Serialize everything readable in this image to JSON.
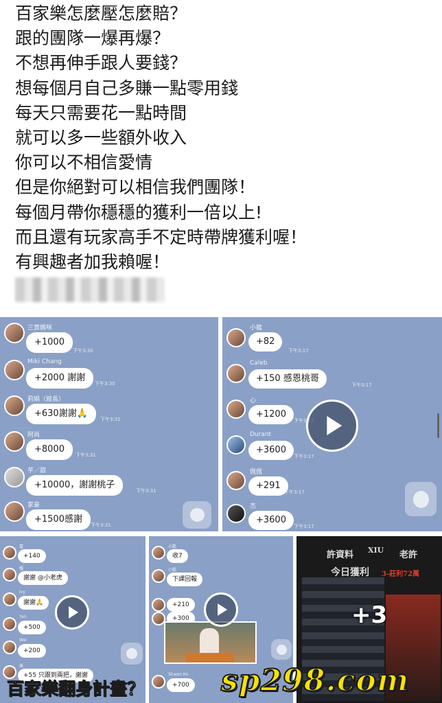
{
  "post": {
    "lines": [
      "百家樂怎麼壓怎麼賠？",
      "跟的團隊一爆再爆？",
      "不想再伸手跟人要錢？",
      "想每個月自己多賺一點零用錢",
      "每天只需要花一點時間",
      "就可以多一些額外收入",
      "你可以不相信愛情",
      "但是你絕對可以相信我們團隊！",
      "每個月帶你穩穩的獲利一倍以上!",
      "而且還有玩家高手不定時帶牌獲利喔！",
      "有興趣者加我賴喔！"
    ]
  },
  "gallery": {
    "panel1": {
      "messages": [
        {
          "name": "三寶媽咪",
          "text": "+1000",
          "time": "下午3:30"
        },
        {
          "name": "Miki Chang",
          "text": "+2000 謝謝",
          "time": "下午3:30"
        },
        {
          "name": "莉娟（館長）",
          "text": "+630謝謝🙏",
          "time": "下午3:31"
        },
        {
          "name": "阿尚",
          "text": "+8000",
          "time": "下午3:31"
        },
        {
          "name": "芋／甜",
          "text": "+10000，謝謝桃子",
          "time": "下午3:31"
        },
        {
          "name": "家豪",
          "text": "+1500感謝",
          "time": "下午3:31"
        }
      ]
    },
    "panel2": {
      "messages": [
        {
          "name": "小龍",
          "text": "+82",
          "time": "下午3:17"
        },
        {
          "name": "Caleb",
          "text": "+150 感恩桃哥",
          "time": "下午3:17"
        },
        {
          "name": "心",
          "text": "+1200",
          "time": "下午3:17"
        },
        {
          "name": "Durant",
          "text": "+3600",
          "time": "下午3:17"
        },
        {
          "name": "佩佩",
          "text": "+291",
          "time": "下午3:17"
        },
        {
          "name": "杰",
          "text": "+3600",
          "time": "下午3:17"
        }
      ]
    },
    "panel3": {
      "messages": [
        {
          "name": "富",
          "text": "+140"
        },
        {
          "name": "暢",
          "text": "謝謝 @小老虎"
        },
        {
          "name": "Ivy",
          "text": "謝謝🙏"
        },
        {
          "name": "Yan",
          "text": "+500"
        },
        {
          "name": "Wei",
          "text": "+200"
        },
        {
          "name": "美",
          "text": "+55 只跟到兩把，謝謝"
        }
      ]
    },
    "panel4": {
      "messages": [
        {
          "name": "小凱",
          "text": "收7"
        },
        {
          "name": "小凱",
          "text": "下課回報"
        },
        {
          "name": "",
          "text": "+210"
        },
        {
          "name": "",
          "text": "+300"
        },
        {
          "name": "Shawn Ko",
          "text": "+700"
        }
      ]
    },
    "panel5": {
      "header_left": "許資料",
      "header_mid": "XIU",
      "header_right": "老許",
      "subheader": "今日獲利",
      "subheader_tag": "3-莊利72萬",
      "more_count": "+3"
    }
  },
  "overlay": {
    "caption": "百家樂翻身計畫？",
    "watermark": "sp298.com"
  },
  "colors": {
    "chat_bg": "#8aa0c6",
    "caption": "#f2f250",
    "watermark": "#f8e200"
  },
  "icons": [
    "play-icon",
    "floating-action-icon",
    "avatar"
  ]
}
